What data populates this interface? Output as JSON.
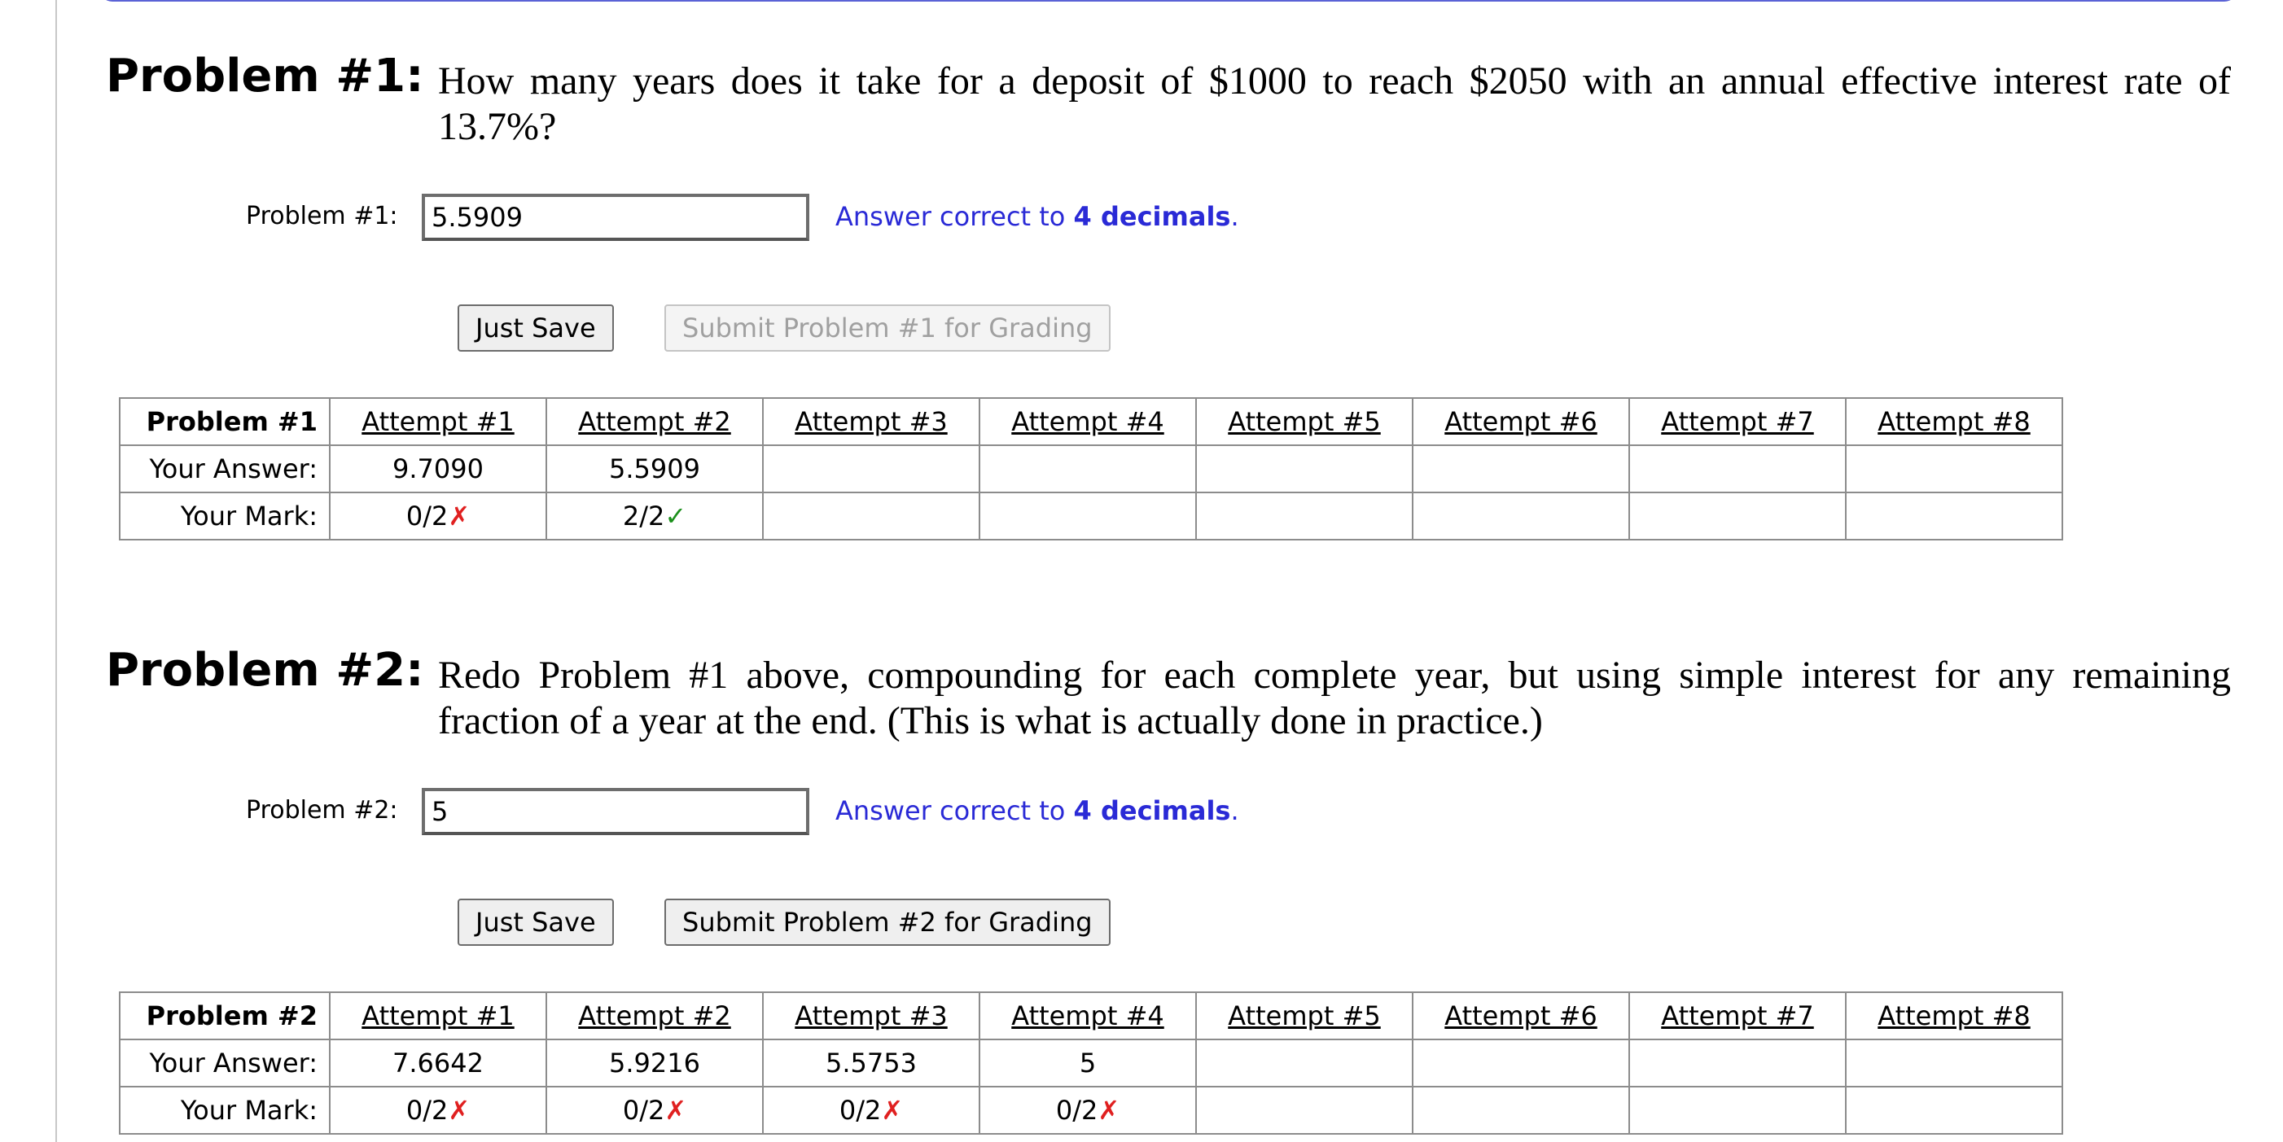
{
  "problems": [
    {
      "title": "Problem #1:",
      "text": "How many years does it take for a deposit of $1000 to reach $2050 with an annual effective interest rate of 13.7%?",
      "field_label": "Problem #1:",
      "input_value": "5.5909",
      "hint_prefix": "Answer correct to",
      "hint_bold": "4 decimals",
      "hint_suffix": ".",
      "save_label": "Just Save",
      "submit_label": "Submit Problem #1 for Grading",
      "submit_disabled": true,
      "table": {
        "corner": "Problem #1",
        "answer_label": "Your Answer:",
        "mark_label": "Your Mark:",
        "attempts": [
          "Attempt #1",
          "Attempt #2",
          "Attempt #3",
          "Attempt #4",
          "Attempt #5",
          "Attempt #6",
          "Attempt #7",
          "Attempt #8"
        ],
        "answers": [
          "9.7090",
          "5.5909",
          "",
          "",
          "",
          "",
          "",
          ""
        ],
        "marks": [
          "0/2",
          "2/2",
          "",
          "",
          "",
          "",
          "",
          ""
        ],
        "mark_symbols": [
          "✗",
          "✓",
          "",
          "",
          "",
          "",
          "",
          ""
        ]
      }
    },
    {
      "title": "Problem #2:",
      "text": "Redo Problem #1 above, compounding for each complete year, but using simple interest for any remaining fraction of a year at the end. (This is what is actually done in practice.)",
      "field_label": "Problem #2:",
      "input_value": "5",
      "hint_prefix": "Answer correct to",
      "hint_bold": "4 decimals",
      "hint_suffix": ".",
      "save_label": "Just Save",
      "submit_label": "Submit Problem #2 for Grading",
      "submit_disabled": false,
      "table": {
        "corner": "Problem #2",
        "answer_label": "Your Answer:",
        "mark_label": "Your Mark:",
        "attempts": [
          "Attempt #1",
          "Attempt #2",
          "Attempt #3",
          "Attempt #4",
          "Attempt #5",
          "Attempt #6",
          "Attempt #7",
          "Attempt #8"
        ],
        "answers": [
          "7.6642",
          "5.9216",
          "5.5753",
          "5",
          "",
          "",
          "",
          ""
        ],
        "marks": [
          "0/2",
          "0/2",
          "0/2",
          "0/2",
          "",
          "",
          "",
          ""
        ],
        "mark_symbols": [
          "✗",
          "✗",
          "✗",
          "✗",
          "",
          "",
          "",
          ""
        ]
      }
    }
  ],
  "colors": {
    "hint": "#2a2ad6",
    "wrong_mark": "#e02020",
    "correct_mark": "#1a8f1a",
    "top_border": "#5a62d6"
  }
}
